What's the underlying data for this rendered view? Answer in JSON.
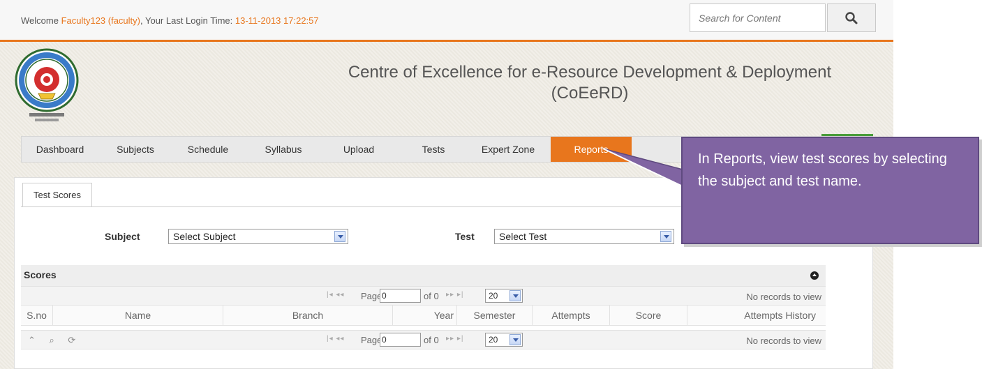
{
  "topbar": {
    "welcome_prefix": "Welcome ",
    "user": "Faculty123 (faculty)",
    "login_label": ", Your Last Login Time: ",
    "login_time": "13-11-2013 17:22:57",
    "search_placeholder": "Search for Content",
    "search_icon": "search-icon"
  },
  "header": {
    "title_line1": "Centre of Excellence for e-Resource Development & Deployment",
    "title_line2": "(CoEeRD)",
    "logo": "jntu-kakinada-logo"
  },
  "nav": {
    "items": [
      "Dashboard",
      "Subjects",
      "Schedule",
      "Syllabus",
      "Upload",
      "Tests",
      "Expert Zone",
      "Reports"
    ],
    "active": "Reports"
  },
  "tabs": [
    "Test Scores"
  ],
  "filters": {
    "subject_label": "Subject",
    "subject_value": "Select Subject",
    "test_label": "Test",
    "test_value": "Select Test"
  },
  "scores": {
    "title": "Scores",
    "page_label": "Page",
    "page_value": "0",
    "of_label": "of 0",
    "page_size": "20",
    "no_records": "No records to view",
    "columns": [
      "S.no",
      "Name",
      "Branch",
      "Year",
      "Semester",
      "Attempts",
      "Score",
      "Attempts History"
    ]
  },
  "callout": {
    "text": "In Reports, view test scores by selecting the subject and test name."
  },
  "colors": {
    "accent": "#e8761d",
    "callout_bg": "#8064a2",
    "green_bar": "#4a9d3a"
  }
}
